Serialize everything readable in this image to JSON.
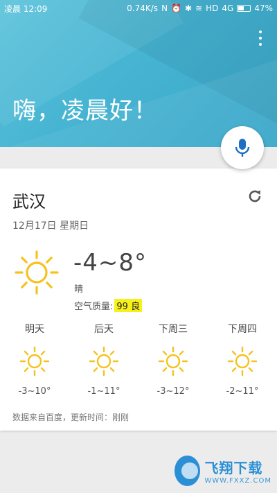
{
  "status_bar": {
    "time": "凌晨 12:09",
    "net_speed": "0.74K/s",
    "network": "HD",
    "signal": "4G",
    "battery": "47%"
  },
  "header": {
    "greeting": "嗨，凌晨好！"
  },
  "weather": {
    "city": "武汉",
    "date": "12月17日 星期日",
    "temp_range": "-4~8°",
    "condition": "晴",
    "aqi_label": "空气质量:",
    "aqi_value": "99 良",
    "forecast": [
      {
        "day": "明天",
        "temp": "-3~10°",
        "icon": "sun-icon"
      },
      {
        "day": "后天",
        "temp": "-1~11°",
        "icon": "sun-icon"
      },
      {
        "day": "下周三",
        "temp": "-3~12°",
        "icon": "sun-icon"
      },
      {
        "day": "下周四",
        "temp": "-2~11°",
        "icon": "sun-icon"
      }
    ],
    "source": "数据来自百度，更新时间：刚刚"
  },
  "watermark": {
    "title": "飞翔下载",
    "url": "WWW.FXXZ.COM"
  },
  "colors": {
    "header": "#46b4d2",
    "sun": "#f5c21e",
    "aqi_highlight": "#f7f11a",
    "mic": "#1f6fc5"
  }
}
